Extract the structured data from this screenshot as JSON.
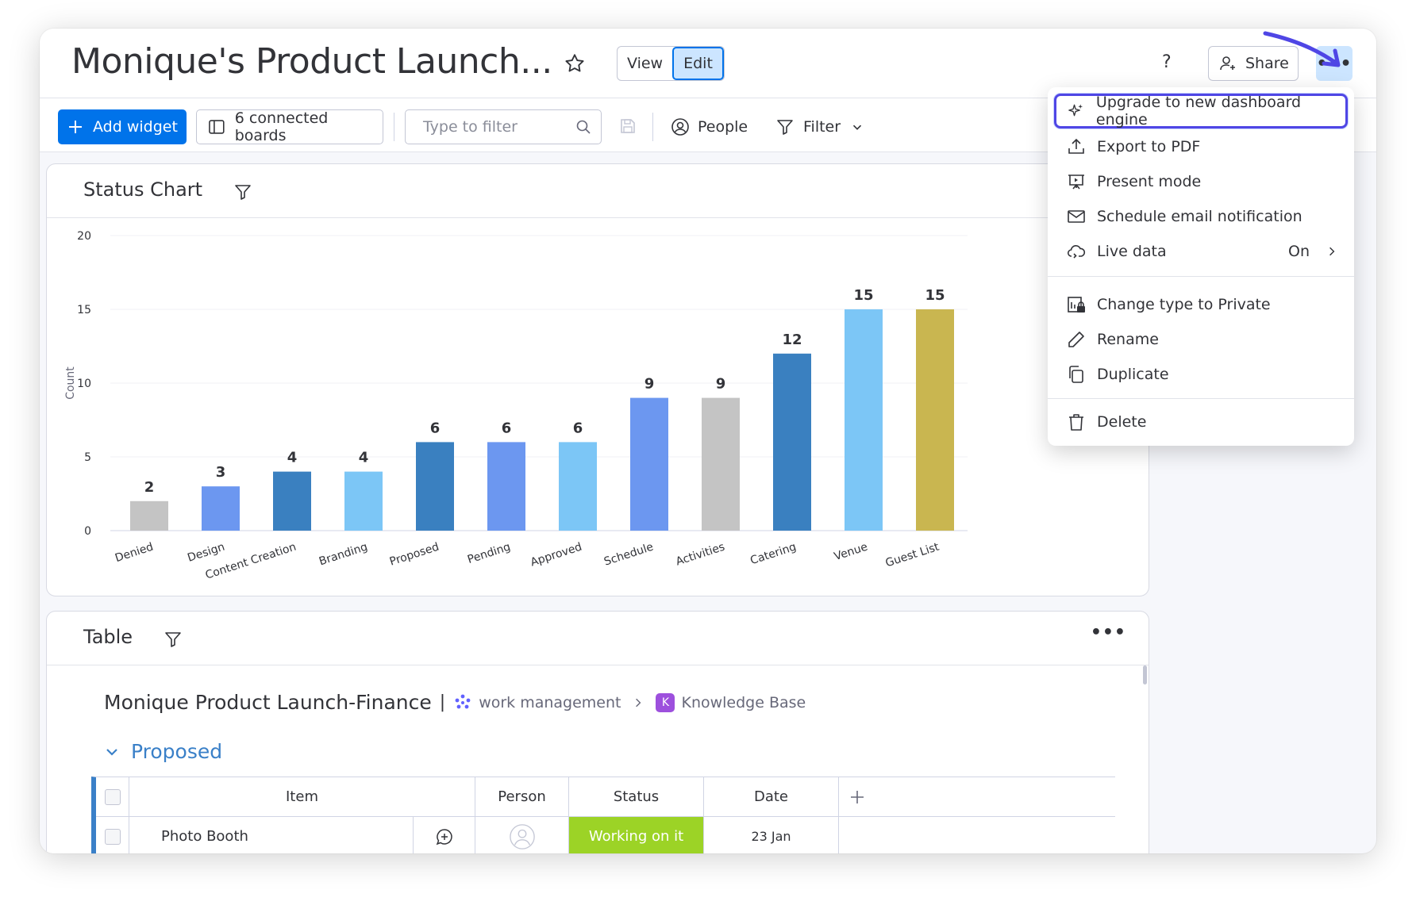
{
  "header": {
    "title": "Monique's Product Launch...",
    "view_label": "View",
    "edit_label": "Edit",
    "help_label": "?",
    "share_label": "Share",
    "more_label": "•••"
  },
  "toolbar": {
    "add_widget_label": "Add widget",
    "boards_label": "6 connected boards",
    "filter_placeholder": "Type to filter",
    "people_label": "People",
    "filter_label": "Filter"
  },
  "status_chart": {
    "title": "Status Chart"
  },
  "chart_data": {
    "type": "bar",
    "ylabel": "Count",
    "xlabel": "",
    "ylim": [
      0,
      20
    ],
    "yticks": [
      0,
      5,
      10,
      15,
      20
    ],
    "categories": [
      "Denied",
      "Design",
      "Content Creation",
      "Branding",
      "Proposed",
      "Pending",
      "Approved",
      "Schedule",
      "Activities",
      "Catering",
      "Venue",
      "Guest List"
    ],
    "values": [
      2,
      3,
      4,
      4,
      6,
      6,
      6,
      9,
      9,
      12,
      15,
      15
    ],
    "colors": [
      "#c4c4c4",
      "#6c97f0",
      "#3a80c0",
      "#7cc6f6",
      "#3a80c0",
      "#6c97f0",
      "#7cc6f6",
      "#6c97f0",
      "#c4c4c4",
      "#3a80c0",
      "#7cc6f6",
      "#c9b650"
    ],
    "grid": true,
    "data_labels": true
  },
  "table_widget": {
    "title": "Table",
    "more_label": "•••",
    "board_name": "Monique Product Launch-Finance",
    "separator": "|",
    "workspace": "work management",
    "kb_badge": "K",
    "kb_name": "Knowledge Base",
    "group_name": "Proposed",
    "columns": [
      "Item",
      "Person",
      "Status",
      "Date"
    ],
    "rows": [
      {
        "item": "Photo Booth",
        "status": "Working on it",
        "date": "23 Jan"
      }
    ],
    "status_color": "#9cd326"
  },
  "menu": {
    "items": [
      {
        "label": "Upgrade to new dashboard engine",
        "icon": "sparkle-icon"
      },
      {
        "label": "Export to PDF",
        "icon": "upload-icon"
      },
      {
        "label": "Present mode",
        "icon": "present-icon"
      },
      {
        "label": "Schedule email notification",
        "icon": "mail-icon"
      },
      {
        "label": "Live data",
        "icon": "cloud-icon",
        "value": "On"
      },
      {
        "label": "Change type to Private",
        "icon": "lock-board-icon"
      },
      {
        "label": "Rename",
        "icon": "pencil-icon"
      },
      {
        "label": "Duplicate",
        "icon": "duplicate-icon"
      },
      {
        "label": "Delete",
        "icon": "trash-icon"
      }
    ]
  },
  "colors": {
    "primary": "#0073ea",
    "highlight_border": "#4f46e5",
    "group_color": "#3a80c8"
  }
}
